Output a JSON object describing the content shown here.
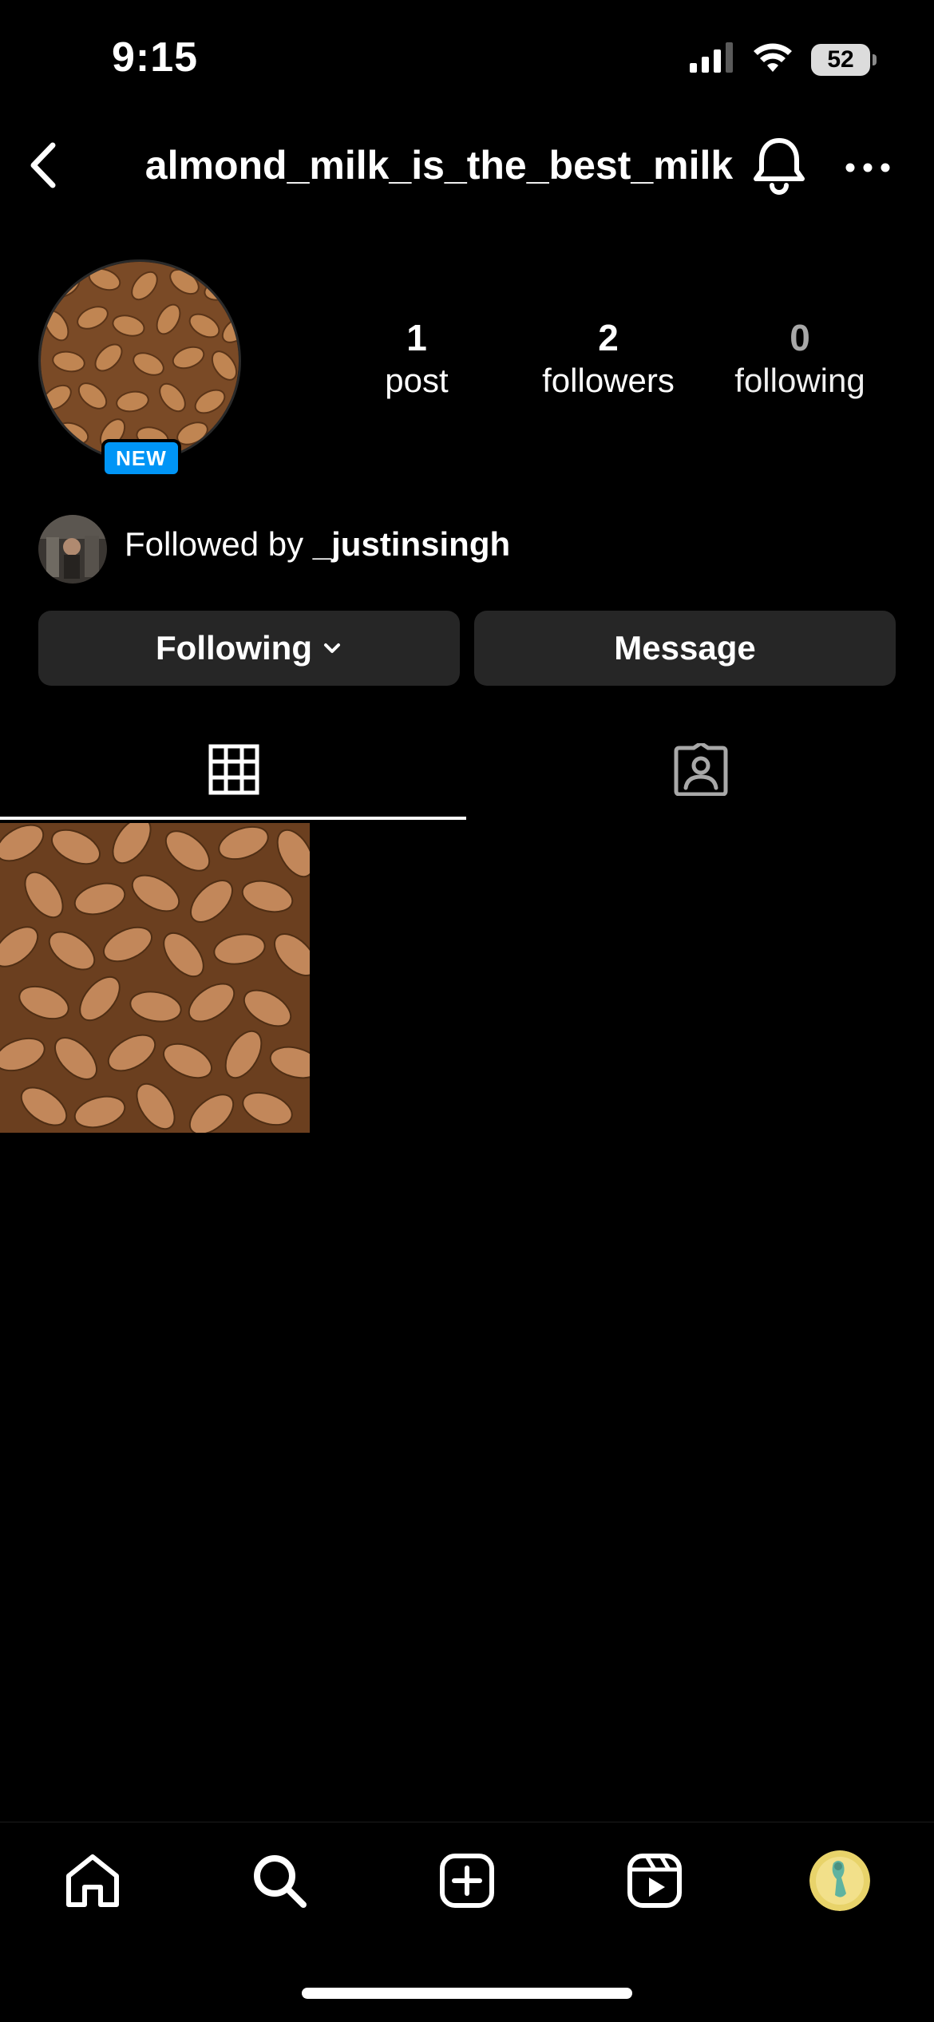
{
  "status_bar": {
    "time": "9:15",
    "battery": "52",
    "icons": [
      "signal-icon",
      "wifi-icon",
      "battery-icon"
    ]
  },
  "header": {
    "username": "almond_milk_is_the_best_milk",
    "back_icon": "chevron-left-icon",
    "bell_icon": "bell-icon",
    "more_icon": "more-horizontal-icon"
  },
  "profile": {
    "new_badge": "NEW",
    "stats": {
      "posts": {
        "count": "1",
        "label": "post"
      },
      "followers": {
        "count": "2",
        "label": "followers"
      },
      "following": {
        "count": "0",
        "label": "following"
      }
    },
    "followed_by": {
      "prefix": "Followed by",
      "user": "_justinsingh"
    }
  },
  "actions": {
    "following_label": "Following",
    "message_label": "Message"
  },
  "tabs": {
    "active": "grid",
    "items": [
      "grid-icon",
      "tagged-icon"
    ]
  },
  "colors": {
    "background": "#000000",
    "button": "#262626",
    "badge": "#0095f6",
    "muted": "#a8a8a8"
  },
  "bottom_nav": [
    "home-icon",
    "search-icon",
    "create-icon",
    "reels-icon",
    "profile-avatar"
  ]
}
